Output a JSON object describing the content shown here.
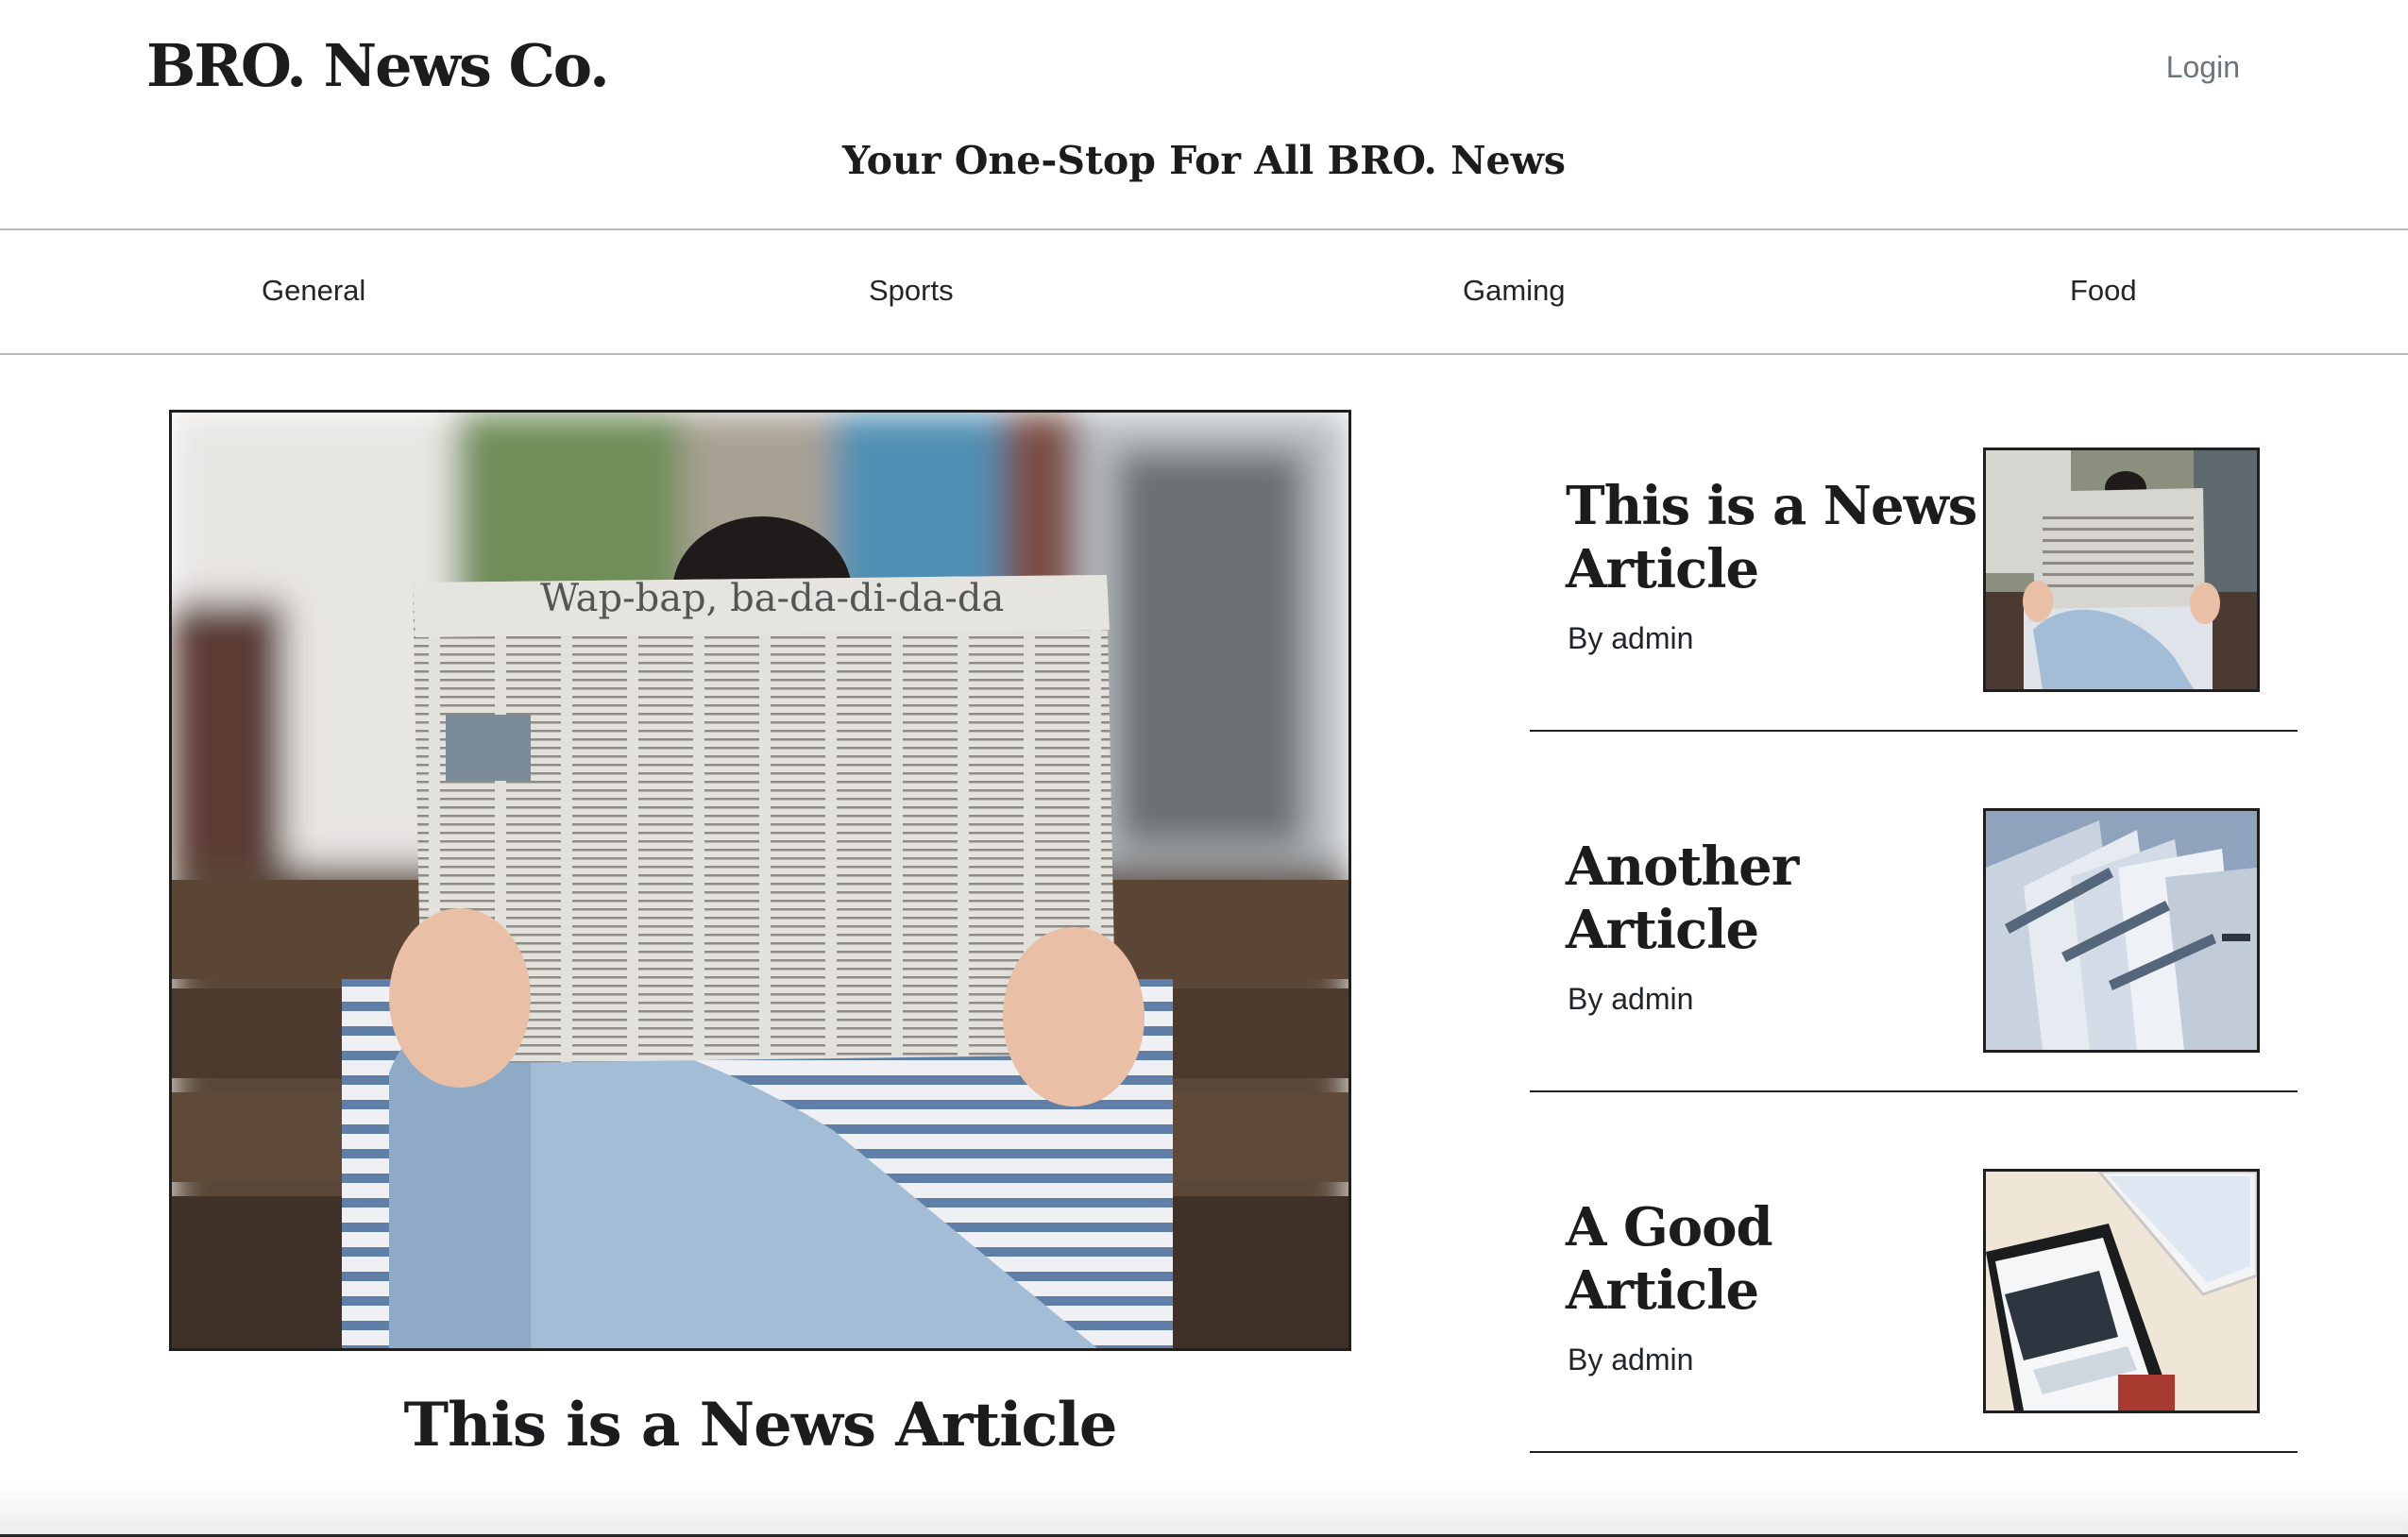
{
  "header": {
    "brand": "BRO. News Co.",
    "login_label": "Login",
    "tagline": "Your One-Stop For All BRO. News"
  },
  "nav": {
    "items": [
      {
        "label": "General"
      },
      {
        "label": "Sports"
      },
      {
        "label": "Gaming"
      },
      {
        "label": "Food"
      }
    ]
  },
  "featured": {
    "title": "This is a News Article",
    "image": "man-reading-newspaper-photo",
    "newspaper_headline": "Wap-bap, ba-da-di-da-da"
  },
  "side_articles": [
    {
      "title": "This is a News Article",
      "author": "By admin",
      "image": "man-reading-newspaper-photo"
    },
    {
      "title": "Another Article",
      "author": "By admin",
      "image": "stacked-newspapers-photo"
    },
    {
      "title": "A Good Article",
      "author": "By admin",
      "image": "phone-and-tablet-news-photo"
    }
  ],
  "colors": {
    "text": "#212529",
    "muted": "#6c757d",
    "border": "#1f1f1f",
    "nav_border": "#b9b9b9",
    "background": "#ffffff"
  }
}
